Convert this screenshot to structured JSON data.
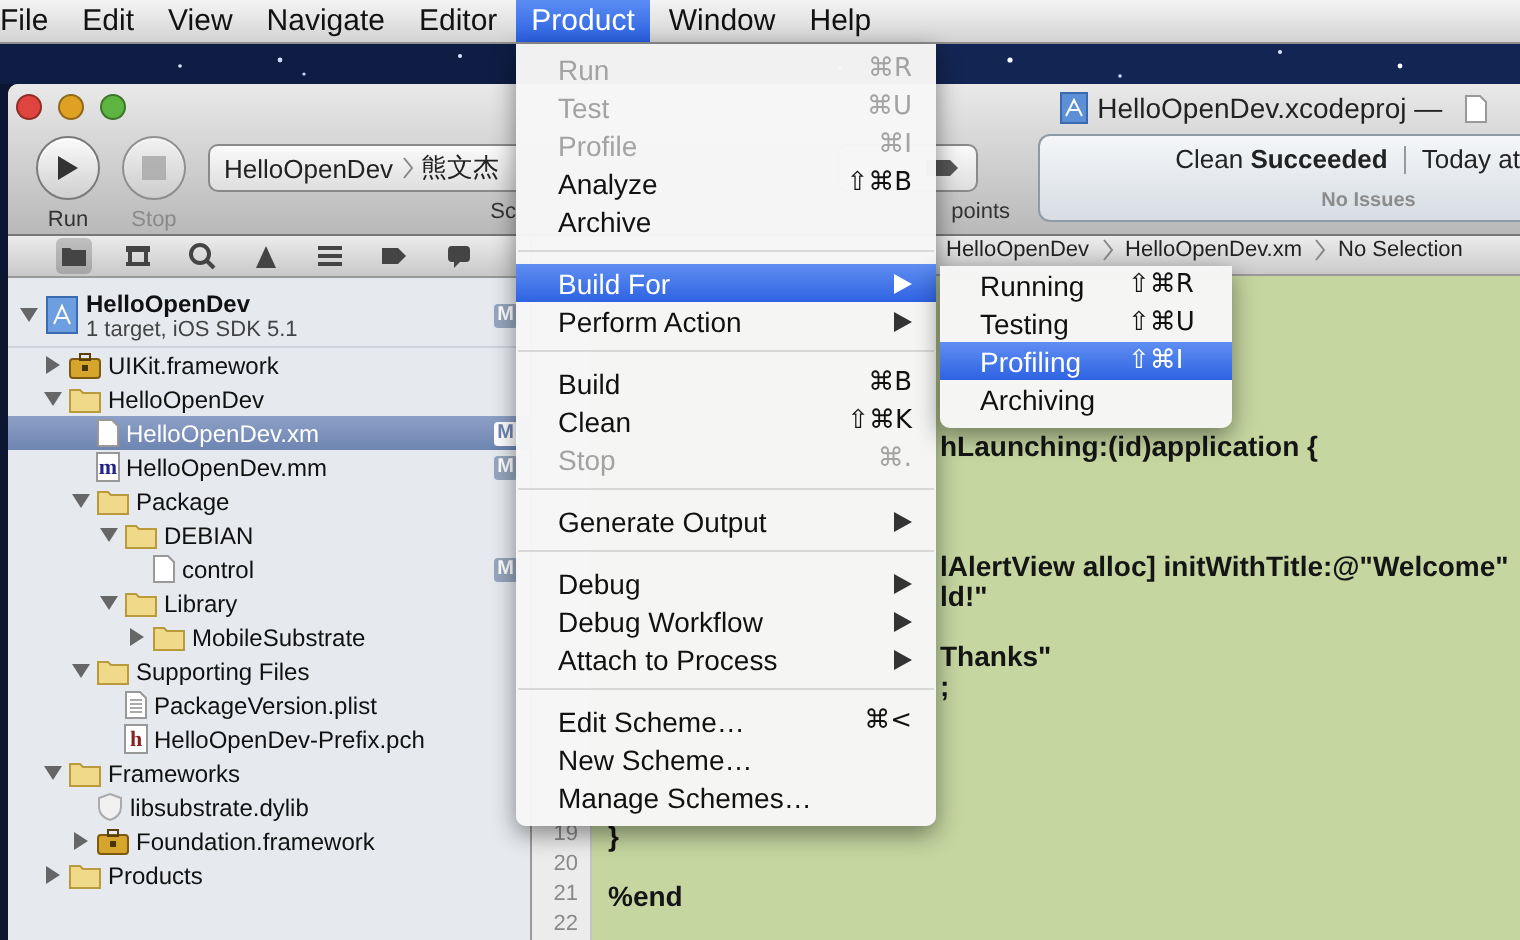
{
  "menubar": {
    "items": [
      {
        "label": "File",
        "selected": false
      },
      {
        "label": "Edit",
        "selected": false
      },
      {
        "label": "View",
        "selected": false
      },
      {
        "label": "Navigate",
        "selected": false
      },
      {
        "label": "Editor",
        "selected": false
      },
      {
        "label": "Product",
        "selected": true
      },
      {
        "label": "Window",
        "selected": false
      },
      {
        "label": "Help",
        "selected": false
      }
    ]
  },
  "window": {
    "title": "HelloOpenDev.xcodeproj —",
    "buttons": [
      {
        "kind": "run",
        "label": "Run",
        "disabled": false
      },
      {
        "kind": "stop",
        "label": "Stop",
        "disabled": true
      }
    ],
    "scheme": {
      "project": "HelloOpenDev",
      "device": "熊文杰",
      "label": "Sc"
    },
    "breakpoints": {
      "label": "points"
    },
    "activity": {
      "message": "Clean **Succeeded**",
      "time": "Today at",
      "issues": "No Issues"
    }
  },
  "navigator": {
    "tabs": [
      {
        "kind": "folder",
        "selected": true
      },
      {
        "kind": "hierarchy",
        "selected": false
      },
      {
        "kind": "search",
        "selected": false
      },
      {
        "kind": "warning",
        "selected": false
      },
      {
        "kind": "list",
        "selected": false
      },
      {
        "kind": "tag",
        "selected": false
      },
      {
        "kind": "log",
        "selected": false
      }
    ]
  },
  "project": {
    "name": "HelloOpenDev",
    "subtitle": "1 target, iOS SDK 5.1",
    "status": "M",
    "expanded": true,
    "children": [
      {
        "name": "UIKit.framework",
        "kind": "framework",
        "expanded": false,
        "selected": false
      },
      {
        "name": "HelloOpenDev",
        "kind": "folder",
        "expanded": true,
        "selected": false,
        "children": [
          {
            "name": "HelloOpenDev.xm",
            "kind": "file",
            "status": "M",
            "selected": true
          },
          {
            "name": "HelloOpenDev.mm",
            "kind": "source",
            "icon_letter": "m",
            "status": "M",
            "selected": false
          },
          {
            "name": "Package",
            "kind": "folder",
            "expanded": true,
            "selected": false,
            "children": [
              {
                "name": "DEBIAN",
                "kind": "folder",
                "expanded": true,
                "selected": false,
                "children": [
                  {
                    "name": "control",
                    "kind": "file",
                    "status": "M",
                    "selected": false
                  }
                ]
              },
              {
                "name": "Library",
                "kind": "folder",
                "expanded": true,
                "selected": false,
                "children": [
                  {
                    "name": "MobileSubstrate",
                    "kind": "folder",
                    "expanded": false,
                    "selected": false
                  }
                ]
              }
            ]
          },
          {
            "name": "Supporting Files",
            "kind": "folder",
            "expanded": true,
            "selected": false,
            "children": [
              {
                "name": "PackageVersion.plist",
                "kind": "plist",
                "selected": false
              },
              {
                "name": "HelloOpenDev-Prefix.pch",
                "kind": "header",
                "icon_letter": "h",
                "selected": false
              }
            ]
          }
        ]
      },
      {
        "name": "Frameworks",
        "kind": "folder",
        "expanded": true,
        "selected": false,
        "children": [
          {
            "name": "libsubstrate.dylib",
            "kind": "library",
            "selected": false
          },
          {
            "name": "Foundation.framework",
            "kind": "framework",
            "expanded": false,
            "selected": false
          }
        ]
      },
      {
        "name": "Products",
        "kind": "folder",
        "expanded": false,
        "selected": false
      }
    ]
  },
  "jump_bar": [
    "HelloOpenDev",
    "HelloOpenDev.xm",
    "No Selection"
  ],
  "editor": {
    "lines": [
      {
        "kind": "covered"
      },
      {
        "kind": "covered"
      },
      {
        "kind": "covered"
      },
      {
        "kind": "covered"
      },
      {
        "kind": "covered"
      },
      {
        "kind": "partial",
        "text": "hLaunching:(id)application {"
      },
      {
        "kind": "covered"
      },
      {
        "kind": "covered"
      },
      {
        "kind": "covered"
      },
      {
        "kind": "partial",
        "text": "lAlertView alloc] initWithTitle:@\"Welcome\""
      },
      {
        "kind": "partial",
        "text": "ld!\""
      },
      {
        "kind": "covered"
      },
      {
        "kind": "partial",
        "text": "Thanks\""
      },
      {
        "kind": "partial",
        "text": ";"
      },
      {
        "kind": "covered"
      },
      {
        "kind": "covered"
      },
      {
        "kind": "covered"
      },
      {
        "kind": "covered"
      },
      {
        "kind": "full",
        "number": "19",
        "text": "}"
      },
      {
        "kind": "full",
        "number": "20"
      },
      {
        "kind": "full",
        "number": "21",
        "text": "%end"
      },
      {
        "kind": "full",
        "number": "22"
      }
    ]
  },
  "product_menu": {
    "items": [
      {
        "kind": "item",
        "label": "Run",
        "shortcut": "⌘R",
        "disabled": true,
        "selected": false
      },
      {
        "kind": "item",
        "label": "Test",
        "shortcut": "⌘U",
        "disabled": true,
        "selected": false
      },
      {
        "kind": "item",
        "label": "Profile",
        "shortcut": "⌘I",
        "disabled": true,
        "selected": false
      },
      {
        "kind": "item",
        "label": "Analyze",
        "shortcut": "⇧⌘B",
        "disabled": false,
        "selected": false
      },
      {
        "kind": "item",
        "label": "Archive",
        "disabled": false,
        "selected": false
      },
      {
        "kind": "separator"
      },
      {
        "kind": "submenu",
        "label": "Build For",
        "disabled": false,
        "selected": true
      },
      {
        "kind": "submenu",
        "label": "Perform Action",
        "disabled": false,
        "selected": false
      },
      {
        "kind": "separator"
      },
      {
        "kind": "item",
        "label": "Build",
        "shortcut": "⌘B",
        "disabled": false,
        "selected": false
      },
      {
        "kind": "item",
        "label": "Clean",
        "shortcut": "⇧⌘K",
        "disabled": false,
        "selected": false
      },
      {
        "kind": "item",
        "label": "Stop",
        "shortcut": "⌘.",
        "disabled": true,
        "selected": false
      },
      {
        "kind": "separator"
      },
      {
        "kind": "submenu",
        "label": "Generate Output",
        "disabled": false,
        "selected": false
      },
      {
        "kind": "separator"
      },
      {
        "kind": "submenu",
        "label": "Debug",
        "disabled": false,
        "selected": false
      },
      {
        "kind": "submenu",
        "label": "Debug Workflow",
        "disabled": false,
        "selected": false
      },
      {
        "kind": "submenu",
        "label": "Attach to Process",
        "disabled": false,
        "selected": false
      },
      {
        "kind": "separator"
      },
      {
        "kind": "item",
        "label": "Edit Scheme…",
        "shortcut": "⌘<",
        "disabled": false,
        "selected": false
      },
      {
        "kind": "item",
        "label": "New Scheme…",
        "disabled": false,
        "selected": false
      },
      {
        "kind": "item",
        "label": "Manage Schemes…",
        "disabled": false,
        "selected": false
      }
    ]
  },
  "build_for_menu": {
    "items": [
      {
        "kind": "item",
        "label": "Running",
        "shortcut": "⇧⌘R",
        "disabled": false,
        "selected": false
      },
      {
        "kind": "item",
        "label": "Testing",
        "shortcut": "⇧⌘U",
        "disabled": false,
        "selected": false
      },
      {
        "kind": "item",
        "label": "Profiling",
        "shortcut": "⇧⌘I",
        "disabled": false,
        "selected": true
      },
      {
        "kind": "item",
        "label": "Archiving",
        "disabled": false,
        "selected": false
      }
    ]
  }
}
